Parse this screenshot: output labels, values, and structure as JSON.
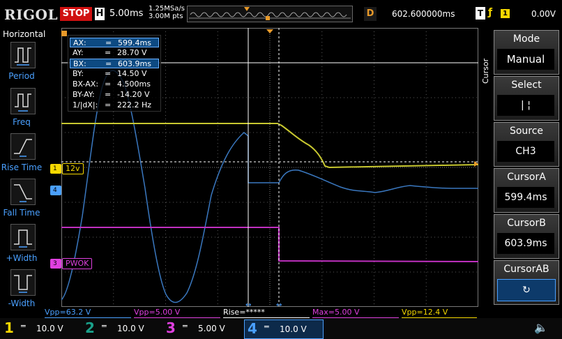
{
  "header": {
    "brand": "RIGOL",
    "run_state": "STOP",
    "h_label": "H",
    "h_timebase": "5.00ms",
    "sample_rate": "1.25MSa/s",
    "mem_depth": "3.00M pts",
    "d_label": "D",
    "delay": "602.600000ms",
    "t_label": "T",
    "trigger_channel": "1",
    "trigger_level": "0.00V",
    "colors": {
      "stop": "#d01010",
      "delay_label": "#e89a2a"
    }
  },
  "left_panel": {
    "title": "Horizontal",
    "items": [
      {
        "label": "Period",
        "icon": "period-icon"
      },
      {
        "label": "Freq",
        "icon": "freq-icon"
      },
      {
        "label": "Rise Time",
        "icon": "rise-time-icon"
      },
      {
        "label": "Fall Time",
        "icon": "fall-time-icon"
      },
      {
        "label": "+Width",
        "icon": "plus-width-icon"
      },
      {
        "label": "-Width",
        "icon": "minus-width-icon"
      }
    ]
  },
  "cursor_readout": [
    {
      "key": "AX:",
      "eq": "=",
      "val": "599.4ms",
      "highlight": true
    },
    {
      "key": "AY:",
      "eq": "=",
      "val": "28.70 V",
      "highlight": false
    },
    {
      "key": "BX:",
      "eq": "=",
      "val": "603.9ms",
      "highlight": true
    },
    {
      "key": "BY:",
      "eq": "=",
      "val": "14.50 V",
      "highlight": false
    },
    {
      "key": "BX-AX:",
      "eq": "=",
      "val": "4.500ms",
      "highlight": false
    },
    {
      "key": "BY-AY:",
      "eq": "=",
      "val": "-14.20 V",
      "highlight": false
    },
    {
      "key": "1/|dX|:",
      "eq": "=",
      "val": "222.2 Hz",
      "highlight": false
    }
  ],
  "channel_labels": {
    "ch1_marker": "1",
    "ch1_tag": "12v",
    "ch3_marker": "3",
    "ch3_tag": "PWOK",
    "ch4_marker": "4"
  },
  "right_panel": {
    "vertical_title": "Cursor",
    "mode_label": "Mode",
    "mode_value": "Manual",
    "select_label": "Select",
    "select_value": "|   ¦",
    "source_label": "Source",
    "source_value": "CH3",
    "cursor_a_label": "CursorA",
    "cursor_a_value": "599.4ms",
    "cursor_b_label": "CursorB",
    "cursor_b_value": "603.9ms",
    "cursor_ab_label": "CursorAB",
    "cursor_ab_icon": "cycle-icon"
  },
  "measurements": [
    {
      "text": "Vpp=63.2 V",
      "color": "#4aa0ff"
    },
    {
      "text": "Vpp=5.00 V",
      "color": "#e040e0"
    },
    {
      "text": "Rise=*****",
      "color": "#ffffff"
    },
    {
      "text": "Max=5.00 V",
      "color": "#e040e0"
    },
    {
      "text": "Vpp=12.4 V",
      "color": "#f5d800"
    }
  ],
  "channels": [
    {
      "num": "1",
      "scale": "10.0 V",
      "color": "#f5d800"
    },
    {
      "num": "2",
      "scale": "10.0 V",
      "color": "#1aa08a"
    },
    {
      "num": "3",
      "scale": "5.00 V",
      "color": "#e040e0"
    },
    {
      "num": "4",
      "scale": "10.0 V",
      "color": "#4aa0ff"
    }
  ],
  "channel_coupling": "═",
  "colors": {
    "ch1": "#c8c830",
    "ch3": "#c030c0",
    "ch4": "#3a78c0",
    "cursor": "#ffffff",
    "grid": "#555555",
    "trigger": "#e89a2a"
  }
}
